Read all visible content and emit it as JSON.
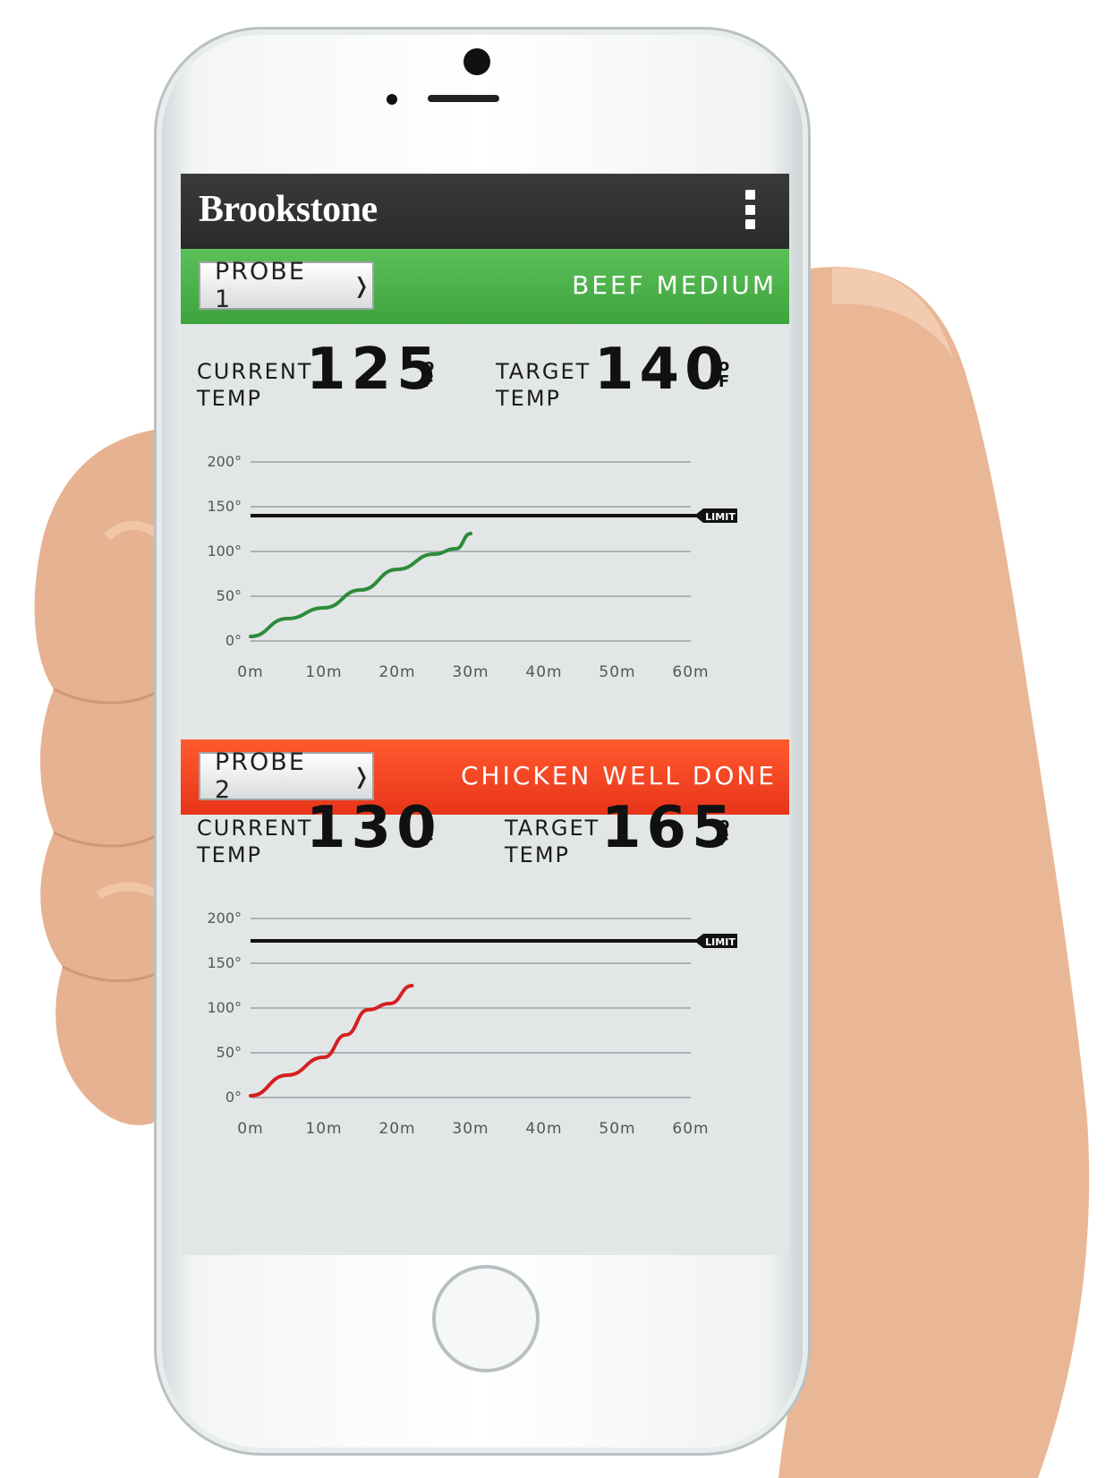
{
  "app": {
    "brand": "Brookstone",
    "menu_icon": "kebab-menu-icon"
  },
  "colors": {
    "header": "#2f2f2f",
    "probe1_bar": "#47ae45",
    "probe2_bar": "#f0401f",
    "probe1_line": "#2e8b3a",
    "probe2_line": "#d42020",
    "limit_line": "#111111"
  },
  "probes": [
    {
      "button_label": "PROBE 1",
      "chevron": "❭",
      "recipe": "BEEF MEDIUM",
      "current_label": [
        "CURRENT",
        "TEMP"
      ],
      "current_value": "125",
      "target_label": [
        "TARGET",
        "TEMP"
      ],
      "target_value": "140",
      "unit_top": "o",
      "unit_bottom": "F"
    },
    {
      "button_label": "PROBE 2",
      "chevron": "❭",
      "recipe": "CHICKEN WELL DONE",
      "current_label": [
        "CURRENT",
        "TEMP"
      ],
      "current_value": "130",
      "target_label": [
        "TARGET",
        "TEMP"
      ],
      "target_value": "165",
      "unit_top": "o",
      "unit_bottom": "F"
    }
  ],
  "chart_data": [
    {
      "type": "line",
      "y_ticks": [
        "0°",
        "50°",
        "100°",
        "150°",
        "200°"
      ],
      "x_ticks": [
        "0m",
        "10m",
        "20m",
        "30m",
        "40m",
        "50m",
        "60m"
      ],
      "ylim": [
        0,
        200
      ],
      "xlim": [
        0,
        60
      ],
      "limit": 140,
      "limit_label": "LIMIT",
      "series": [
        {
          "x": [
            0,
            5,
            10,
            15,
            20,
            25,
            28,
            30
          ],
          "y": [
            5,
            25,
            37,
            57,
            80,
            97,
            103,
            120
          ]
        }
      ]
    },
    {
      "type": "line",
      "y_ticks": [
        "0°",
        "50°",
        "100°",
        "150°",
        "200°"
      ],
      "x_ticks": [
        "0m",
        "10m",
        "20m",
        "30m",
        "40m",
        "50m",
        "60m"
      ],
      "ylim": [
        0,
        200
      ],
      "xlim": [
        0,
        60
      ],
      "limit": 175,
      "limit_label": "LIMIT",
      "series": [
        {
          "x": [
            0,
            5,
            10,
            13,
            16,
            19,
            22
          ],
          "y": [
            2,
            25,
            45,
            70,
            98,
            105,
            125
          ]
        }
      ]
    }
  ]
}
